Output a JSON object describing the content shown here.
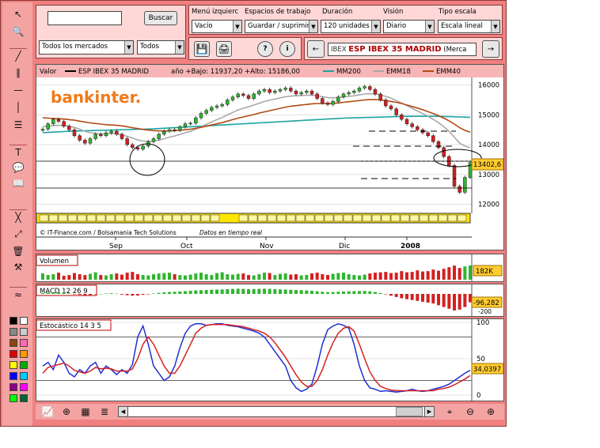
{
  "search": {
    "placeholder": "",
    "button": "Buscar"
  },
  "filters": {
    "market": "Todos los mercados",
    "type": "Todos"
  },
  "settings": {
    "menu_label": "Menú izquierc",
    "menu_value": "Vacío",
    "workspace_label": "Espacios de trabajo",
    "workspace_value": "Guardar / suprimir",
    "duration_label": "Duración",
    "duration_value": "120 unidades",
    "view_label": "Visión",
    "view_value": "Diario",
    "scale_label": "Tipo escala",
    "scale_value": "Escala lineal"
  },
  "instrument": {
    "code": "IBEX",
    "name": "ESP IBEX 35 MADRID",
    "market": "(Merca"
  },
  "chart_header": {
    "label": "Valor",
    "series": "ESP IBEX 35 MADRID",
    "range": "año +Bajo: 11937,20 +Alto: 15186,00",
    "mm200": "MM200",
    "emm18": "EMM18",
    "emm40": "EMM40"
  },
  "brand": "bankinter.",
  "credit": "© IT-Finance.com / Bolsamania Tech Solutions",
  "credit_note": "Datos en tiempo real",
  "current_price": "13402,6",
  "volume": {
    "label": "Volumen",
    "value": "182K"
  },
  "macd": {
    "label": "MACD 12 26 9",
    "value": "-96,282",
    "tick_low": "-200"
  },
  "stoch": {
    "label": "Estocástico 14 3 5",
    "value": "34,0397"
  },
  "colors": {
    "frame": "#f08080",
    "mm200": "#1aa3a3",
    "emm18": "#a8a8a8",
    "emm40": "#b34a12",
    "up": "#2fb52f",
    "down": "#d42020"
  },
  "chart_data": [
    {
      "type": "candlestick",
      "title": "ESP IBEX 35 MADRID",
      "x_ticks": [
        "Sep",
        "Oct",
        "Nov",
        "Dic",
        "2008"
      ],
      "y_ticks": [
        12000,
        13000,
        14000,
        15000,
        16000
      ],
      "ylim": [
        11800,
        16150
      ],
      "close": [
        14520,
        14700,
        14850,
        14780,
        14620,
        14500,
        14300,
        14150,
        14050,
        14200,
        14350,
        14300,
        14400,
        14450,
        14350,
        14200,
        14000,
        13900,
        13850,
        13950,
        14100,
        14200,
        14350,
        14450,
        14500,
        14480,
        14600,
        14700,
        14720,
        14900,
        15050,
        15150,
        15250,
        15300,
        15350,
        15500,
        15600,
        15700,
        15650,
        15550,
        15700,
        15800,
        15850,
        15750,
        15800,
        15850,
        15900,
        15800,
        15700,
        15750,
        15800,
        15700,
        15550,
        15400,
        15350,
        15450,
        15600,
        15700,
        15750,
        15800,
        15900,
        15950,
        15850,
        15700,
        15500,
        15300,
        15200,
        15000,
        14850,
        14700,
        14600,
        14500,
        14400,
        14300,
        14100,
        13900,
        13600,
        13300,
        12600,
        12400,
        12900,
        13400
      ],
      "mm200": [
        14400,
        14410,
        14420,
        14430,
        14440,
        14450,
        14455,
        14460,
        14465,
        14470,
        14475,
        14480,
        14485,
        14490,
        14495,
        14500,
        14505,
        14510,
        14515,
        14520,
        14525,
        14530,
        14540,
        14550,
        14560,
        14570,
        14580,
        14590,
        14600,
        14610,
        14620,
        14630,
        14640,
        14650,
        14660,
        14670,
        14680,
        14690,
        14700,
        14710,
        14720,
        14730,
        14740,
        14750,
        14760,
        14770,
        14780,
        14790,
        14800,
        14810,
        14820,
        14830,
        14840,
        14850,
        14860,
        14870,
        14880,
        14890,
        14895,
        14900,
        14905,
        14910,
        14915,
        14920,
        14925,
        14930,
        14935,
        14940,
        14945,
        14950,
        14950,
        14950,
        14950,
        14950,
        14950,
        14950,
        14945,
        14940,
        14935,
        14930,
        14925,
        14920
      ],
      "emm18": [
        14600,
        14620,
        14640,
        14650,
        14640,
        14620,
        14580,
        14520,
        14450,
        14400,
        14380,
        14360,
        14360,
        14370,
        14360,
        14330,
        14280,
        14220,
        14160,
        14120,
        14110,
        14120,
        14150,
        14200,
        14250,
        14290,
        14340,
        14400,
        14450,
        14520,
        14600,
        14680,
        14760,
        14840,
        14910,
        15000,
        15080,
        15160,
        15220,
        15270,
        15330,
        15390,
        15450,
        15490,
        15530,
        15570,
        15610,
        15630,
        15640,
        15650,
        15660,
        15660,
        15640,
        15610,
        15580,
        15570,
        15580,
        15600,
        15620,
        15640,
        15670,
        15700,
        15710,
        15700,
        15670,
        15620,
        15560,
        15480,
        15400,
        15310,
        15220,
        15130,
        15040,
        14950,
        14850,
        14740,
        14600,
        14450,
        14250,
        14050,
        13950,
        13900
      ],
      "emm40": [
        14900,
        14890,
        14880,
        14870,
        14860,
        14840,
        14820,
        14790,
        14760,
        14730,
        14710,
        14690,
        14670,
        14660,
        14650,
        14630,
        14600,
        14570,
        14540,
        14510,
        14490,
        14470,
        14460,
        14460,
        14460,
        14470,
        14480,
        14500,
        14520,
        14550,
        14580,
        14620,
        14660,
        14700,
        14740,
        14790,
        14840,
        14890,
        14930,
        14970,
        15010,
        15060,
        15100,
        15140,
        15180,
        15220,
        15260,
        15290,
        15310,
        15330,
        15350,
        15370,
        15380,
        15380,
        15380,
        15390,
        15400,
        15420,
        15440,
        15460,
        15480,
        15500,
        15510,
        15510,
        15500,
        15480,
        15450,
        15420,
        15380,
        15330,
        15280,
        15230,
        15170,
        15110,
        15040,
        14970,
        14890,
        14800,
        14690,
        14570,
        14480,
        14420
      ]
    },
    {
      "type": "bar",
      "title": "Volumen",
      "values": [
        80,
        60,
        70,
        90,
        50,
        60,
        85,
        70,
        60,
        75,
        95,
        60,
        55,
        70,
        80,
        65,
        90,
        100,
        70,
        60,
        55,
        70,
        80,
        85,
        90,
        70,
        60,
        55,
        65,
        80,
        90,
        70,
        60,
        85,
        95,
        70,
        65,
        75,
        80,
        60,
        55,
        70,
        90,
        85,
        60,
        75,
        80,
        65,
        70,
        55,
        60,
        80,
        90,
        70,
        60,
        75,
        85,
        90,
        70,
        60,
        55,
        65,
        80,
        90,
        95,
        100,
        85,
        90,
        110,
        95,
        100,
        120,
        105,
        110,
        130,
        115,
        140,
        160,
        180,
        150,
        170,
        182
      ]
    },
    {
      "type": "bar",
      "title": "MACD 12 26 9",
      "values": [
        10,
        15,
        20,
        18,
        12,
        5,
        -5,
        -10,
        -15,
        -12,
        -5,
        0,
        5,
        8,
        3,
        -8,
        -15,
        -20,
        -18,
        -10,
        -5,
        5,
        12,
        18,
        22,
        25,
        28,
        32,
        36,
        40,
        42,
        45,
        48,
        50,
        52,
        55,
        58,
        60,
        58,
        55,
        56,
        58,
        60,
        58,
        55,
        52,
        50,
        48,
        45,
        43,
        40,
        36,
        30,
        25,
        20,
        22,
        25,
        28,
        30,
        32,
        33,
        34,
        30,
        22,
        10,
        -5,
        -20,
        -35,
        -50,
        -60,
        -70,
        -80,
        -90,
        -100,
        -110,
        -130,
        -150,
        -170,
        -190,
        -180,
        -150,
        -96
      ]
    },
    {
      "type": "line",
      "title": "Estocástico 14 3 5",
      "y_ticks": [
        0,
        50,
        100
      ],
      "ylim": [
        0,
        100
      ],
      "series": [
        {
          "values": [
            40,
            45,
            35,
            55,
            45,
            30,
            25,
            35,
            30,
            40,
            45,
            30,
            40,
            35,
            28,
            35,
            30,
            42,
            80,
            95,
            70,
            40,
            30,
            20,
            25,
            40,
            65,
            85,
            95,
            98,
            98,
            96,
            97,
            98,
            98,
            96,
            95,
            94,
            92,
            90,
            88,
            85,
            80,
            70,
            60,
            50,
            40,
            20,
            10,
            5,
            8,
            15,
            40,
            70,
            90,
            95,
            98,
            96,
            92,
            70,
            40,
            20,
            10,
            8,
            5,
            6,
            5,
            4,
            5,
            6,
            8,
            6,
            5,
            6,
            8,
            10,
            12,
            15,
            20,
            25,
            30,
            34
          ]
        },
        {
          "values": [
            30,
            38,
            40,
            42,
            44,
            40,
            34,
            32,
            30,
            33,
            38,
            36,
            37,
            36,
            33,
            33,
            33,
            36,
            50,
            70,
            80,
            70,
            55,
            40,
            30,
            30,
            40,
            55,
            70,
            85,
            92,
            96,
            97,
            97,
            97,
            97,
            96,
            95,
            94,
            92,
            90,
            88,
            85,
            80,
            72,
            62,
            52,
            40,
            28,
            18,
            12,
            12,
            20,
            35,
            55,
            72,
            85,
            92,
            94,
            88,
            70,
            50,
            32,
            20,
            12,
            9,
            7,
            6,
            6,
            6,
            6,
            6,
            6,
            6,
            6,
            8,
            9,
            11,
            14,
            18,
            22,
            27
          ]
        }
      ]
    }
  ]
}
